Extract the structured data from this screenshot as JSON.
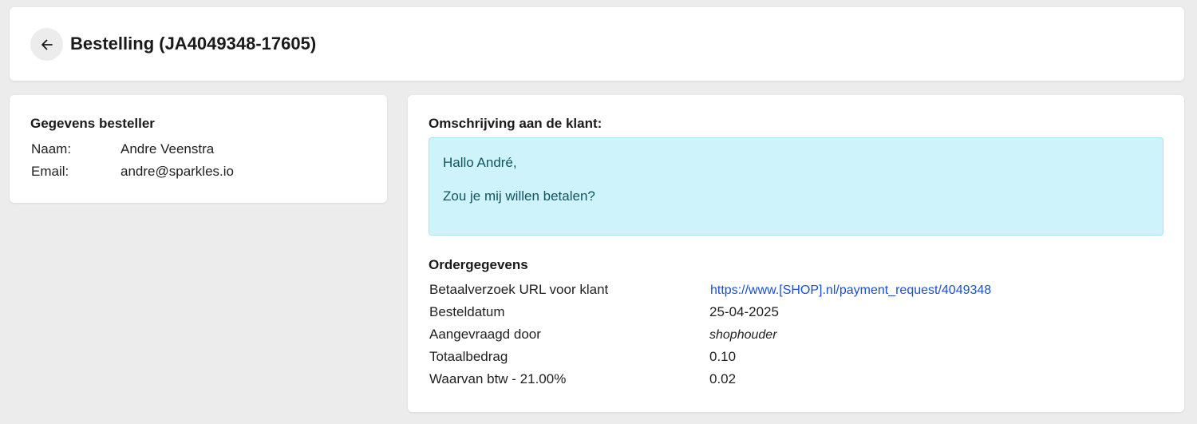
{
  "header": {
    "back_icon": "arrow-left-icon",
    "title": "Bestelling (JA4049348-17605)"
  },
  "customer": {
    "section_title": "Gegevens besteller",
    "name_label": "Naam:",
    "name_value": "Andre Veenstra",
    "email_label": "Email:",
    "email_value": "andre@sparkles.io"
  },
  "description": {
    "section_title": "Omschrijving aan de klant:",
    "line1": "Hallo André,",
    "line2": "Zou je mij willen betalen?",
    "box_color": "#cff3fa",
    "text_color": "#0f5560"
  },
  "order": {
    "section_title": "Ordergegevens",
    "rows": [
      {
        "label": "Betaalverzoek URL voor klant",
        "value": "https://www.[SHOP].nl/payment_request/4049348"
      },
      {
        "label": "Besteldatum",
        "value": "25-04-2025"
      },
      {
        "label": "Aangevraagd door",
        "value": "shophouder"
      },
      {
        "label": "Totaalbedrag",
        "value": "0.10"
      },
      {
        "label": "Waarvan btw - 21.00%",
        "value": "0.02"
      }
    ],
    "link_color": "#1a4fd8"
  }
}
